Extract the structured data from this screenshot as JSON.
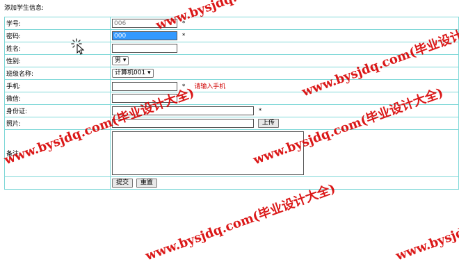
{
  "page": {
    "title": "添加学生信息:"
  },
  "form": {
    "student_no": {
      "label": "学号:",
      "value": "006",
      "required": "*"
    },
    "password": {
      "label": "密码:",
      "value": "000",
      "required": "*"
    },
    "name": {
      "label": "姓名:"
    },
    "gender": {
      "label": "性别:",
      "selected": "男"
    },
    "class_name": {
      "label": "班级名称:",
      "selected": "计算机001"
    },
    "phone": {
      "label": "手机:",
      "required": "*",
      "hint": "请输入手机"
    },
    "wechat": {
      "label": "微信:",
      "required": "*"
    },
    "id_card": {
      "label": "身份证:",
      "required": "*"
    },
    "photo": {
      "label": "照片:",
      "upload_label": "上传"
    },
    "notes": {
      "label": "备注:"
    },
    "submit_label": "提交",
    "reset_label": "重置"
  },
  "watermark": {
    "text": "www.bysjdq.com(毕业设计大全)",
    "color": "#d80000"
  },
  "icons": {
    "cursor": "busy-cursor-icon"
  }
}
